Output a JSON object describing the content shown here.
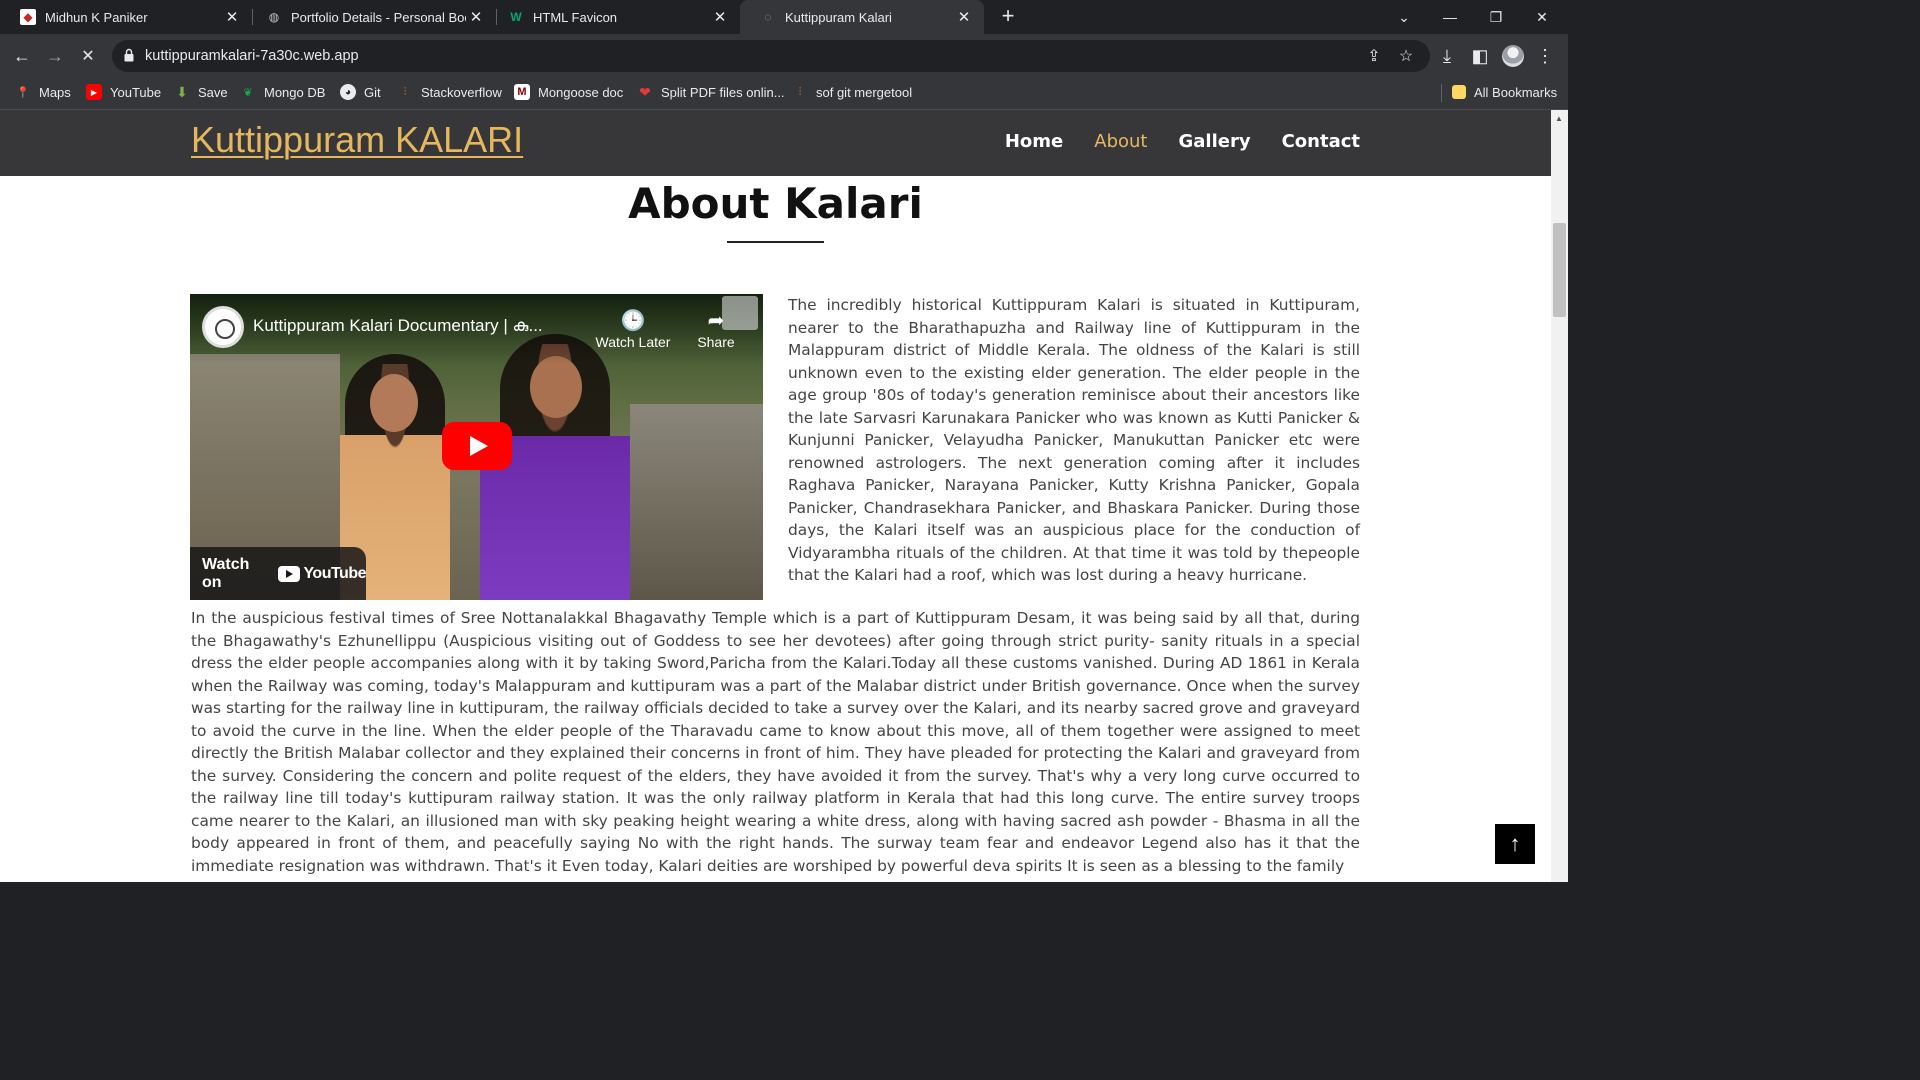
{
  "browser": {
    "tabs": [
      {
        "title": "Midhun K Paniker",
        "icon": "profile-favicon",
        "active": false
      },
      {
        "title": "Portfolio Details - Personal Boot",
        "icon": "globe-icon",
        "active": false
      },
      {
        "title": "HTML Favicon",
        "icon": "w3schools-icon",
        "active": false
      },
      {
        "title": "Kuttippuram Kalari",
        "icon": "globe-icon",
        "active": true
      }
    ],
    "url": "kuttippuramkalari-7a30c.web.app",
    "bookmarks": [
      {
        "label": "Maps",
        "icon": "maps-icon"
      },
      {
        "label": "YouTube",
        "icon": "youtube-icon"
      },
      {
        "label": "Save",
        "icon": "download-arrow-icon"
      },
      {
        "label": "Mongo DB",
        "icon": "mongodb-leaf-icon"
      },
      {
        "label": "Git",
        "icon": "github-icon"
      },
      {
        "label": "Stackoverflow",
        "icon": "stackoverflow-icon"
      },
      {
        "label": "Mongoose doc",
        "icon": "mongoose-icon"
      },
      {
        "label": "Split PDF files onlin...",
        "icon": "pdf-heart-icon"
      },
      {
        "label": "sof git mergetool",
        "icon": "stackoverflow-icon"
      }
    ],
    "all_bookmarks": "All Bookmarks"
  },
  "site": {
    "brand": "Kuttippuram KALARI",
    "nav": [
      {
        "label": "Home",
        "active": false
      },
      {
        "label": "About",
        "active": true
      },
      {
        "label": "Gallery",
        "active": false
      },
      {
        "label": "Contact",
        "active": false
      }
    ],
    "section_title": "About Kalari",
    "video": {
      "title": "Kuttippuram Kalari Documentary | കു...",
      "watch_later": "Watch Later",
      "share": "Share",
      "watch_on": "Watch on",
      "youtube": "YouTube"
    },
    "paragraph1": "The incredibly historical Kuttippuram Kalari is situated in Kuttipuram, nearer to the Bharathapuzha and Railway line of Kuttippuram in the Malappuram district of Middle Kerala. The oldness of the Kalari is still unknown even to the existing elder generation. The elder people in the age group '80s of today's generation reminisce about their ancestors like the late Sarvasri Karunakara Panicker who was known as Kutti Panicker & Kunjunni Panicker, Velayudha Panicker, Manukuttan Panicker etc were renowned astrologers. The next generation coming after it includes Raghava Panicker, Narayana Panicker, Kutty Krishna Panicker, Gopala Panicker, Chandrasekhara Panicker, and Bhaskara Panicker. During those days, the Kalari itself was an auspicious place for the conduction of Vidyarambha rituals of the children. At that time it was told by thepeople that the Kalari had a roof, which was lost during a heavy hurricane.",
    "paragraph2": "In the auspicious festival times of Sree Nottanalakkal Bhagavathy Temple which is a part of Kuttippuram Desam, it was being said by all that, during the Bhagawathy's Ezhunellippu (Auspicious visiting out of Goddess to see her devotees) after going through strict purity- sanity rituals in a special dress the elder people accompanies along with it by taking Sword,Paricha from the Kalari.Today all these customs vanished. During AD 1861 in Kerala when the Railway was coming, today's Malappuram and kuttipuram was a part of the Malabar district under British governance. Once when the survey was starting for the railway line in kuttipuram, the railway officials decided to take a survey over the Kalari, and its nearby sacred grove and graveyard to avoid the curve in the line. When the elder people of the Tharavadu came to know about this move, all of them together were assigned to meet directly the British Malabar collector and they explained their concerns in front of him. They have pleaded for protecting the Kalari and graveyard from the survey. Considering the concern and polite request of the elders, they have avoided it from the survey. That's why a very long curve occurred to the railway line till today's kuttipuram railway station. It was the only railway platform in Kerala that had this long curve. The entire survey troops came nearer to the Kalari, an illusioned man with sky peaking height wearing a white dress, along with having sacred ash powder - Bhasma in all the body appeared in front of them, and peacefully saying No with the right hands. The surway team fear and endeavor Legend also has it that the immediate resignation was withdrawn. That's it Even today, Kalari deities are worshiped by powerful deva spirits It is seen as a blessing to the family"
  }
}
